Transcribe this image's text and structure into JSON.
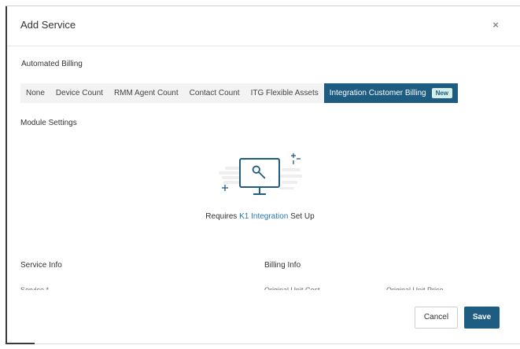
{
  "modal": {
    "title": "Add Service",
    "close_glyph": "×"
  },
  "automated_billing": {
    "label": "Automated Billing",
    "tabs": [
      {
        "label": "None"
      },
      {
        "label": "Device Count"
      },
      {
        "label": "RMM Agent Count"
      },
      {
        "label": "Contact Count"
      },
      {
        "label": "ITG Flexible Assets"
      },
      {
        "label": "Integration Customer Billing",
        "badge": "New",
        "active": true
      }
    ]
  },
  "module_settings": {
    "label": "Module Settings",
    "illustration_icon": "monitor-wrench-icon",
    "requires_prefix": "Requires",
    "requires_link": "K1 Integration",
    "requires_suffix": "Set Up"
  },
  "service_info": {
    "label": "Service Info",
    "cut_field": "Service *"
  },
  "billing_info": {
    "label": "Billing Info",
    "cut_field_1": "Original Unit Cost",
    "cut_field_2": "Original Unit Price"
  },
  "footer": {
    "cancel_label": "Cancel",
    "save_label": "Save"
  },
  "colors": {
    "accent": "#1e5c82",
    "link": "#2a77b0",
    "badge_bg": "#d6efe8"
  }
}
